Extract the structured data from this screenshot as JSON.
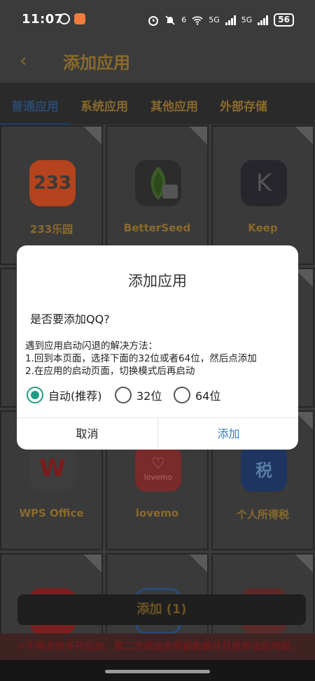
{
  "status_bar": {
    "time": "11:07",
    "network_label_1": "5G",
    "network_label_2": "5G",
    "wifi_badge": "6",
    "battery": "56"
  },
  "header": {
    "back_icon": "chevron-left-icon",
    "title": "添加应用"
  },
  "tabs": [
    {
      "label": "普通应用",
      "active": true
    },
    {
      "label": "系统应用",
      "active": false
    },
    {
      "label": "其他应用",
      "active": false
    },
    {
      "label": "外部存储",
      "active": false
    }
  ],
  "apps": [
    {
      "name": "233乐园",
      "icon_text": "233",
      "color": "#c84a22"
    },
    {
      "name": "BetterSeed",
      "icon_text": "",
      "color": "#2f3a2a"
    },
    {
      "name": "Keep",
      "icon_text": "K",
      "color": "#2a2a33"
    },
    {
      "name": "WPS Office",
      "icon_text": "W",
      "color": "#3a3a3a"
    },
    {
      "name": "lovemo",
      "icon_text": "lovemo",
      "color": "#8a2a2a"
    },
    {
      "name": "个人所得税",
      "icon_text": "税",
      "color": "#1f3a66"
    }
  ],
  "dialog": {
    "title": "添加应用",
    "message": "是否要添加QQ?",
    "tips": [
      "遇到应用启动闪退的解决方法：",
      "1.回到本页面，选择下面的32位或者64位，然后点添加",
      "2.在应用的启动页面，切换模式后再启动"
    ],
    "options": [
      {
        "label": "自动(推荐)",
        "selected": true
      },
      {
        "label": "32位",
        "selected": false
      },
      {
        "label": "64位",
        "selected": false
      }
    ],
    "cancel_label": "取消",
    "confirm_label": "添加"
  },
  "bottom_button": "添加 (1)",
  "notice": "①不再支持多开应用，第二次添加会保留数据并且更新该应用版.."
}
